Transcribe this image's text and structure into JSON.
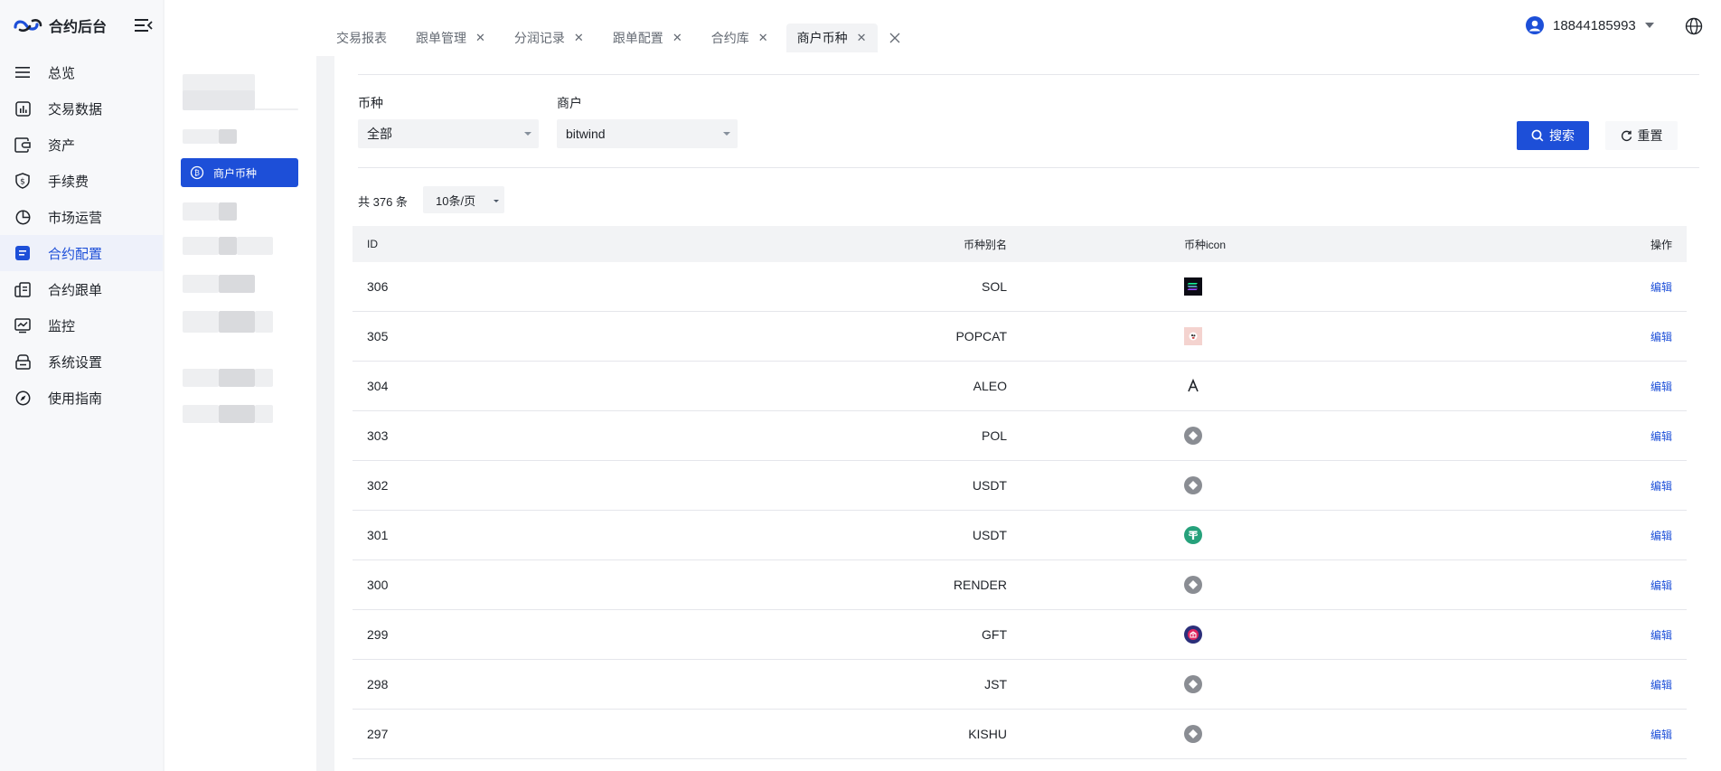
{
  "app": {
    "title": "合约后台"
  },
  "sidebar": {
    "items": [
      {
        "label": "总览",
        "icon": "menu-lines-icon",
        "active": false
      },
      {
        "label": "交易数据",
        "icon": "bar-chart-icon",
        "active": false
      },
      {
        "label": "资产",
        "icon": "wallet-icon",
        "active": false
      },
      {
        "label": "手续费",
        "icon": "dollar-shield-icon",
        "active": false
      },
      {
        "label": "市场运营",
        "icon": "pie-chart-icon",
        "active": false
      },
      {
        "label": "合约配置",
        "icon": "document-icon",
        "active": true
      },
      {
        "label": "合约跟单",
        "icon": "copy-doc-icon",
        "active": false
      },
      {
        "label": "监控",
        "icon": "monitor-icon",
        "active": false
      },
      {
        "label": "系统设置",
        "icon": "settings-box-icon",
        "active": false
      },
      {
        "label": "使用指南",
        "icon": "compass-icon",
        "active": false
      }
    ]
  },
  "subnav": {
    "active_label": "商户币种"
  },
  "tabs": [
    {
      "label": "交易报表",
      "closable": false,
      "active": false
    },
    {
      "label": "跟单管理",
      "closable": true,
      "active": false
    },
    {
      "label": "分润记录",
      "closable": true,
      "active": false
    },
    {
      "label": "跟单配置",
      "closable": true,
      "active": false
    },
    {
      "label": "合约库",
      "closable": true,
      "active": false
    },
    {
      "label": "商户币种",
      "closable": true,
      "active": true
    }
  ],
  "user": {
    "name": "18844185993"
  },
  "filters": {
    "coin": {
      "label": "币种",
      "value": "全部"
    },
    "merchant": {
      "label": "商户",
      "value": "bitwind"
    },
    "search_label": "搜索",
    "reset_label": "重置"
  },
  "pagination": {
    "total_text": "共 376 条",
    "page_size": "10条/页"
  },
  "table": {
    "columns": {
      "id": "ID",
      "alias": "币种别名",
      "icon": "币种icon",
      "op": "操作"
    },
    "edit_label": "编辑",
    "rows": [
      {
        "id": "306",
        "alias": "SOL",
        "icon": "sol-icon"
      },
      {
        "id": "305",
        "alias": "POPCAT",
        "icon": "popcat-icon"
      },
      {
        "id": "304",
        "alias": "ALEO",
        "icon": "aleo-icon"
      },
      {
        "id": "303",
        "alias": "POL",
        "icon": "generic-coin-icon"
      },
      {
        "id": "302",
        "alias": "USDT",
        "icon": "generic-coin-icon"
      },
      {
        "id": "301",
        "alias": "USDT",
        "icon": "tether-icon"
      },
      {
        "id": "300",
        "alias": "RENDER",
        "icon": "generic-coin-icon"
      },
      {
        "id": "299",
        "alias": "GFT",
        "icon": "gft-icon"
      },
      {
        "id": "298",
        "alias": "JST",
        "icon": "generic-coin-icon"
      },
      {
        "id": "297",
        "alias": "KISHU",
        "icon": "generic-coin-icon"
      }
    ]
  },
  "colors": {
    "accent": "#1d4fd8",
    "tether": "#26a17b",
    "generic_coin": "#8a8d93"
  }
}
